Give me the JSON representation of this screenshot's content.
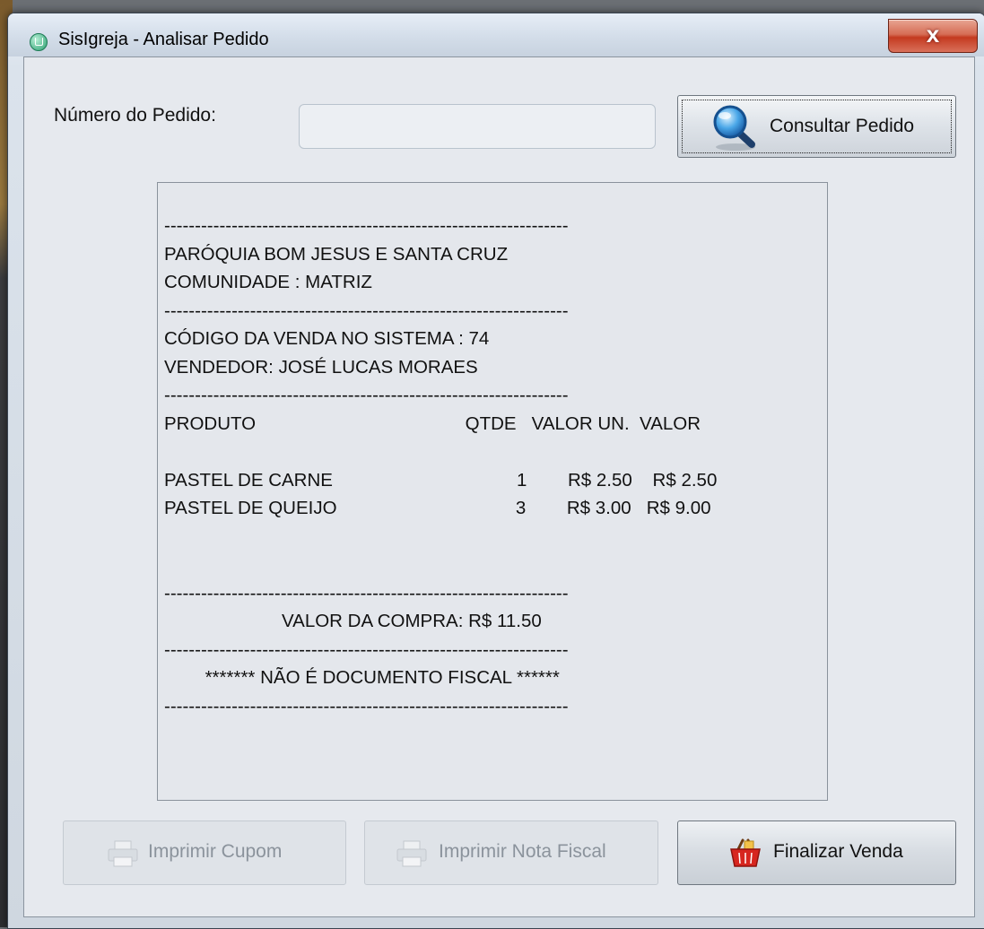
{
  "window": {
    "title": "SisIgreja - Analisar Pedido",
    "close_label": "x"
  },
  "order_search": {
    "label": "Número do Pedido:",
    "input_value": "",
    "button_label": "Consultar Pedido",
    "button_icon": "search-icon"
  },
  "receipt": {
    "lines": [
      "------------------------------------------------------------------",
      "PARÓQUIA BOM JESUS E SANTA CRUZ",
      "COMUNIDADE : MATRIZ",
      "------------------------------------------------------------------",
      "CÓDIGO DA VENDA NO SISTEMA : 74",
      "VENDEDOR: JOSÉ LUCAS MORAES",
      "------------------------------------------------------------------",
      "PRODUTO                                         QTDE   VALOR UN.  VALOR",
      "",
      "PASTEL DE CARNE                                    1        R$ 2.50    R$ 2.50",
      "PASTEL DE QUEIJO                                   3        R$ 3.00   R$ 9.00",
      "",
      "",
      "------------------------------------------------------------------",
      "                       VALOR DA COMPRA: R$ 11.50",
      "------------------------------------------------------------------",
      "        ******* NÃO É DOCUMENTO FISCAL ******",
      "------------------------------------------------------------------"
    ]
  },
  "actions": {
    "print_receipt": {
      "label": "Imprimir Cupom",
      "enabled": false,
      "icon": "printer-icon"
    },
    "print_invoice": {
      "label": "Imprimir Nota Fiscal",
      "enabled": false,
      "icon": "printer-icon"
    },
    "finalize_sale": {
      "label": "Finalizar Venda",
      "enabled": true,
      "icon": "basket-icon"
    }
  },
  "colors": {
    "window_bg": "#e6e9ee",
    "close_button": "#c43a20",
    "disabled_text": "#8b939c"
  }
}
